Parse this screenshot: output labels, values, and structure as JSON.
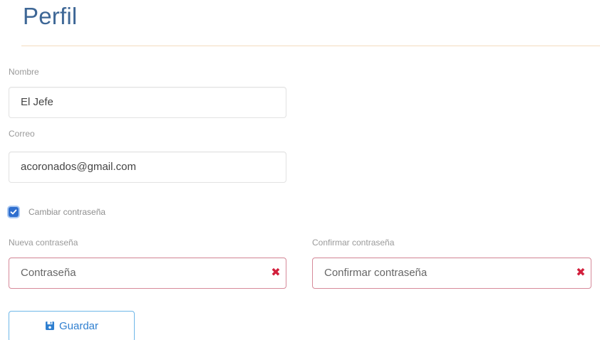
{
  "page": {
    "title": "Perfil"
  },
  "form": {
    "nombre": {
      "label": "Nombre",
      "value": "El Jefe"
    },
    "correo": {
      "label": "Correo",
      "value": "acoronados@gmail.com"
    },
    "change_password": {
      "label": "Cambiar contraseña",
      "checked": true
    },
    "nueva_contrasena": {
      "label": "Nueva contraseña",
      "placeholder": "Contraseña"
    },
    "confirmar_contrasena": {
      "label": "Confirmar contraseña",
      "placeholder": "Confirmar contraseña"
    },
    "save_label": "Guardar"
  },
  "colors": {
    "title": "#3e6796",
    "accent": "#2f7fd0",
    "invalid_border": "#d78a9a",
    "invalid_icon": "#d21f3c",
    "divider": "#f3dcbf"
  },
  "icons": {
    "save": "floppy-disk-icon",
    "clear": "x-icon",
    "checkbox_check": "check-icon"
  }
}
